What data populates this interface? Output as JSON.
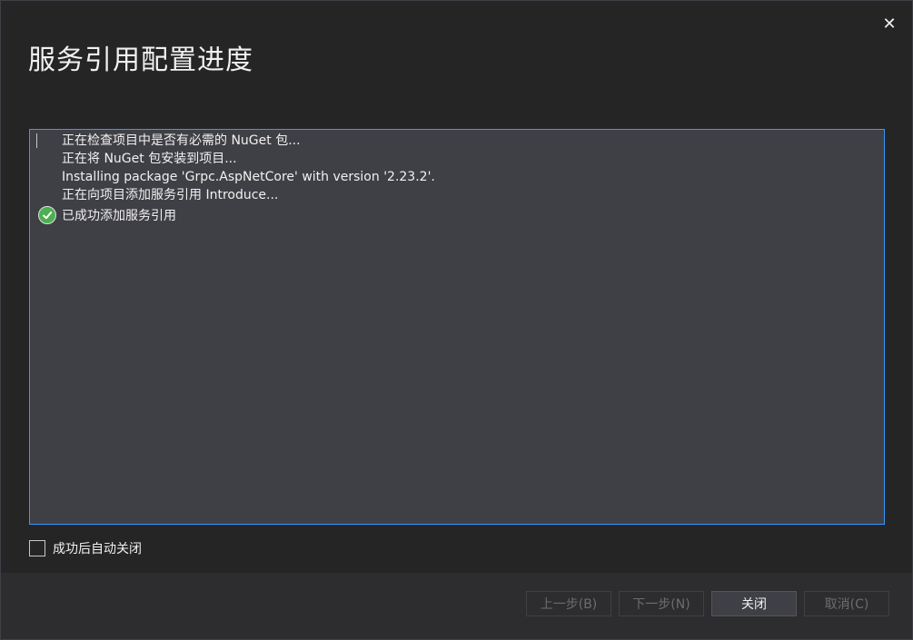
{
  "dialog": {
    "title": "服务引用配置进度",
    "close_glyph": "✕"
  },
  "log": {
    "lines": [
      "正在检查项目中是否有必需的 NuGet 包...",
      "正在将 NuGet 包安装到项目...",
      "Installing package 'Grpc.AspNetCore' with version '2.23.2'.",
      "正在向项目添加服务引用 Introduce..."
    ],
    "success_text": "已成功添加服务引用",
    "success_icon": "check-circle-icon"
  },
  "options": {
    "auto_close_label": "成功后自动关闭",
    "auto_close_checked": false
  },
  "buttons": {
    "prev": "上一步(B)",
    "next": "下一步(N)",
    "close": "关闭",
    "cancel": "取消(C)"
  },
  "colors": {
    "accent": "#3399ff",
    "success": "#4caf50"
  }
}
